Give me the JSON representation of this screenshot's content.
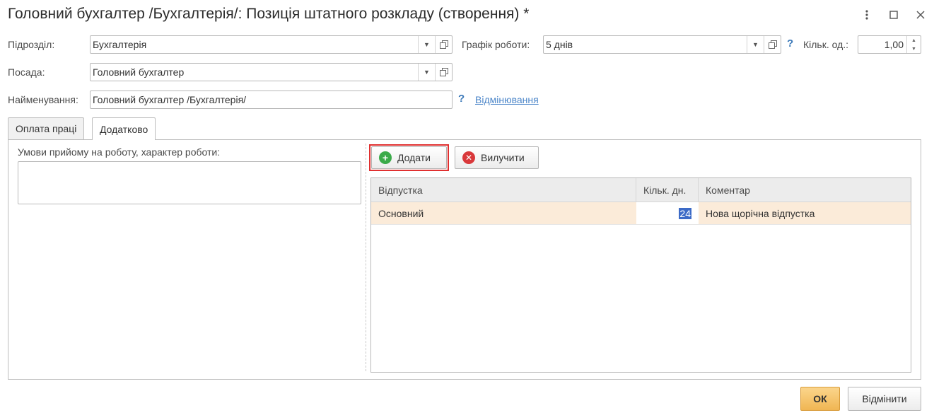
{
  "window": {
    "title": "Головний бухгалтер /Бухгалтерія/: Позиція штатного розкладу (створення) *",
    "more_icon": "more-vertical-icon",
    "maximize_icon": "maximize-icon",
    "close_icon": "close-icon"
  },
  "form": {
    "department_label": "Підрозділ:",
    "department_value": "Бухгалтерія",
    "schedule_label": "Графік роботи:",
    "schedule_value": "5 днів",
    "help_mark": "?",
    "units_label": "Кільк. од.:",
    "units_value": "1,00",
    "position_label": "Посада:",
    "position_value": "Головний бухгалтер",
    "name_label": "Найменування:",
    "name_value": "Головний бухгалтер /Бухгалтерія/",
    "declension_link": "Відмінювання"
  },
  "tabs": [
    {
      "label": "Оплата праці",
      "active": false
    },
    {
      "label": "Додатково",
      "active": true
    }
  ],
  "left_pane": {
    "conditions_label": "Умови прийому на роботу, характер роботи:",
    "conditions_value": ""
  },
  "toolbar": {
    "add_label": "Додати",
    "remove_label": "Вилучити"
  },
  "table": {
    "columns": [
      "Відпустка",
      "Кільк. дн.",
      "Коментар"
    ],
    "rows": [
      {
        "vacation": "Основний",
        "days": "24",
        "comment": "Нова щорічна відпустка"
      }
    ]
  },
  "footer": {
    "ok_label": "ОК",
    "cancel_label": "Відмінити"
  },
  "colors": {
    "accent_ok": "#f0b653",
    "selected_row": "#fbebd9",
    "highlight_box": "#e03030",
    "link": "#4c86c9"
  }
}
